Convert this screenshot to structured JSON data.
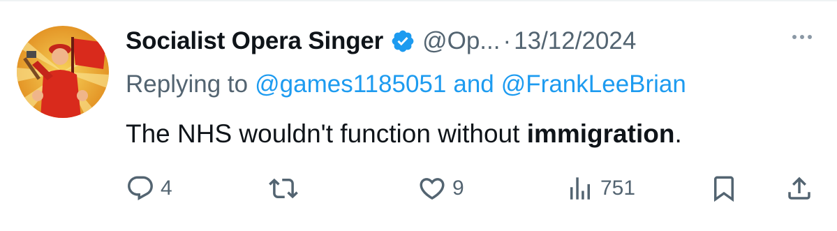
{
  "tweet": {
    "author_name": "Socialist Opera Singer",
    "handle": "@Op...",
    "separator": "·",
    "date": "13/12/2024",
    "replying_prefix": "Replying to",
    "mention_1": "@games1185051",
    "mention_joiner": "and",
    "mention_2": "@FrankLeeBrian",
    "text_plain": "The NHS wouldn't function without ",
    "text_bold": "immigration",
    "text_end": "."
  },
  "actions": {
    "replies": "4",
    "retweets": "",
    "likes": "9",
    "views": "751"
  },
  "icons": {
    "verified": "verified-badge-icon",
    "more": "more-options-icon",
    "reply": "reply-icon",
    "retweet": "retweet-icon",
    "like": "heart-icon",
    "views": "views-bar-chart-icon",
    "bookmark": "bookmark-icon",
    "share": "share-icon"
  },
  "colors": {
    "accent": "#1d9bf0",
    "text_primary": "#0f1419",
    "text_secondary": "#536471",
    "avatar_red": "#d92a1c",
    "avatar_gold": "#f3b32a"
  }
}
